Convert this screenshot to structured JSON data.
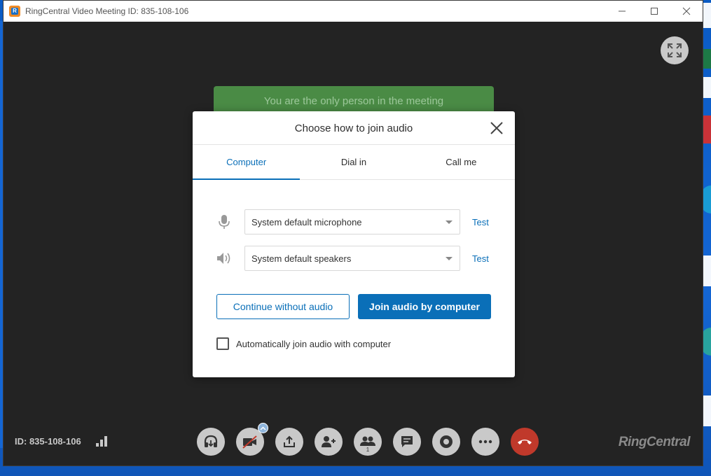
{
  "window": {
    "title": "RingCentral Video Meeting ID: 835-108-106",
    "controls": [
      "minimize",
      "maximize",
      "close"
    ]
  },
  "banner": "You are the only person in the meeting",
  "dialog": {
    "title": "Choose how to join audio",
    "tabs": [
      {
        "label": "Computer",
        "active": true
      },
      {
        "label": "Dial in",
        "active": false
      },
      {
        "label": "Call me",
        "active": false
      }
    ],
    "microphone": {
      "value": "System default microphone",
      "test_label": "Test",
      "icon": "microphone-icon"
    },
    "speakers": {
      "value": "System default speakers",
      "test_label": "Test",
      "icon": "speaker-icon"
    },
    "continue_button": "Continue without audio",
    "join_button": "Join audio by computer",
    "auto_join": {
      "label": "Automatically join audio with computer",
      "checked": false
    }
  },
  "footer": {
    "meeting_id": "ID: 835-108-106",
    "participant_count": "1",
    "brand": "RingCentral",
    "toolbar_icons": [
      "audio-icon",
      "video-off-icon",
      "share-icon",
      "invite-icon",
      "participants-icon",
      "chat-icon",
      "record-icon",
      "more-icon",
      "end-call-icon"
    ]
  },
  "colors": {
    "accent": "#0a6fb8",
    "banner": "#4a8b45",
    "end_call": "#c0392b",
    "stage": "#232323"
  }
}
